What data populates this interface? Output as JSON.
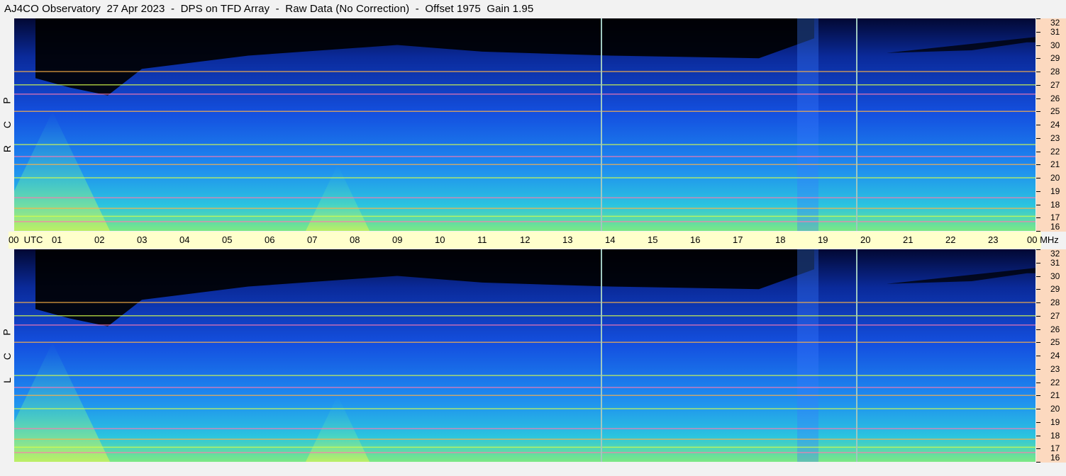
{
  "title": "AJ4CO Observatory  27 Apr 2023  -  DPS on TFD Array  -  Raw Data (No Correction)  -  Offset 1975  Gain 1.95",
  "panels": [
    {
      "id": "rcp",
      "polarization": [
        "R",
        "C",
        "P"
      ]
    },
    {
      "id": "lcp",
      "polarization": [
        "L",
        "C",
        "P"
      ]
    }
  ],
  "utc_axis": {
    "labels": [
      "00  UTC",
      "01",
      "02",
      "03",
      "04",
      "05",
      "06",
      "07",
      "08",
      "09",
      "10",
      "11",
      "12",
      "13",
      "14",
      "15",
      "16",
      "17",
      "18",
      "19",
      "20",
      "21",
      "22",
      "23",
      "00 MHz"
    ]
  },
  "colors": {
    "background": "#f2f2f2",
    "utc_bar": "#ffffcc",
    "freq_axis": "#fcd9bf",
    "colormap": [
      "#000000",
      "#001a66",
      "#0033cc",
      "#1a66ff",
      "#19b5e6",
      "#33e0cc",
      "#ccff33",
      "#ff9933",
      "#ff3399"
    ]
  },
  "chart_data": {
    "type": "heatmap",
    "title": "AJ4CO Observatory  27 Apr 2023  -  DPS on TFD Array  -  Raw Data (No Correction)  -  Offset 1975  Gain 1.95",
    "x": {
      "label": "UTC",
      "range_hours": [
        0,
        24
      ],
      "tick_labels": [
        "00",
        "01",
        "02",
        "03",
        "04",
        "05",
        "06",
        "07",
        "08",
        "09",
        "10",
        "11",
        "12",
        "13",
        "14",
        "15",
        "16",
        "17",
        "18",
        "19",
        "20",
        "21",
        "22",
        "23",
        "00"
      ]
    },
    "y": {
      "label": "MHz",
      "range": [
        16,
        32
      ],
      "ticks": [
        16,
        17,
        18,
        19,
        20,
        21,
        22,
        23,
        24,
        25,
        26,
        27,
        28,
        29,
        30,
        31,
        32
      ]
    },
    "panels": [
      "RCP",
      "LCP"
    ],
    "vertical_markers_utc": [
      13.8,
      19.8
    ],
    "interference_lines_mhz": [
      16.7,
      17.1,
      17.7,
      18.5,
      20.0,
      21.0,
      21.6,
      22.5,
      25.0,
      26.3,
      27.0,
      28.0
    ],
    "features": [
      {
        "name": "dark_band_top",
        "utc": [
          0.5,
          18.8
        ],
        "mhz_min": 27.5
      },
      {
        "name": "burst_column",
        "utc": [
          18.4,
          18.9
        ],
        "mhz": [
          16,
          32
        ]
      },
      {
        "name": "cone",
        "utc_center": 7.6,
        "mhz": [
          16,
          21
        ]
      },
      {
        "name": "cone",
        "utc_center": 0.9,
        "mhz": [
          16,
          25
        ]
      }
    ]
  }
}
